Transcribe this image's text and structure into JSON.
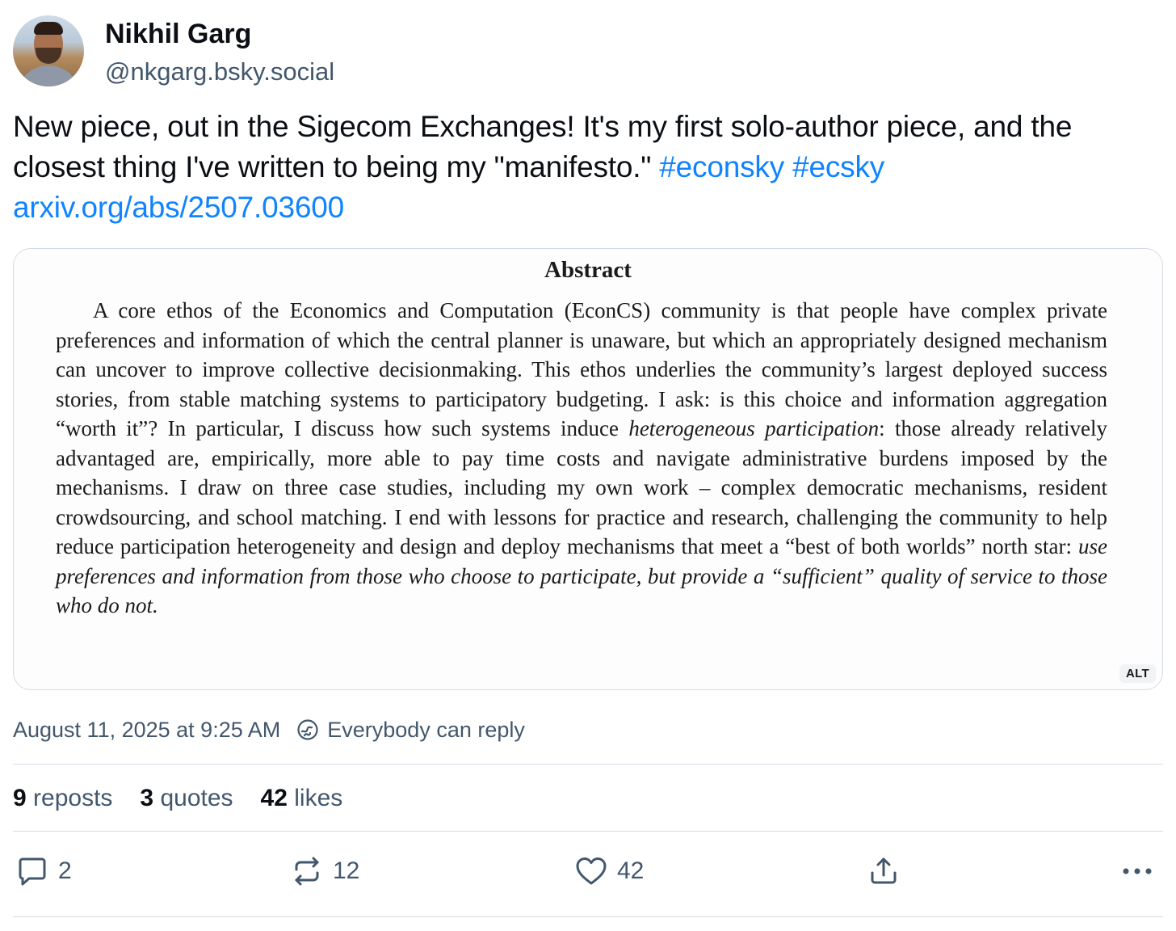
{
  "author": {
    "display_name": "Nikhil Garg",
    "handle": "@nkgarg.bsky.social"
  },
  "post": {
    "text_before_tags": "New piece, out in the Sigecom Exchanges! It's my first solo-author piece, and the closest thing I've written to being my \"manifesto.\" ",
    "hashtags": [
      "#econsky",
      "#ecsky"
    ],
    "link": "arxiv.org/abs/2507.03600"
  },
  "image": {
    "title": "Abstract",
    "body_plain_1": "A core ethos of the Economics and Computation (EconCS) community is that people have complex private preferences and information of which the central planner is unaware, but which an appropriately designed mechanism can uncover to improve collective decisionmaking.  This ethos underlies the community’s largest deployed success stories, from stable matching systems to participatory budgeting.  I ask:  is this choice and information aggregation “worth it”?  In particular, I discuss how such systems induce ",
    "body_italic_1": "heterogeneous participation",
    "body_plain_2": ": those already relatively advantaged are, empirically, more able to pay time costs and navigate administrative burdens imposed by the mechanisms.  I draw on three case studies, including my own work – complex democratic mechanisms, resident crowdsourcing, and school matching.  I end with lessons for practice and research, challenging the community to help reduce participation heterogeneity and design and deploy mechanisms that meet a “best of both worlds” north star: ",
    "body_italic_2": "use preferences and information from those who choose to participate, but provide a “sufficient” quality of service to those who do not.",
    "alt_badge": "ALT"
  },
  "meta": {
    "timestamp": "August 11, 2025 at 9:25 AM",
    "reply_setting": "Everybody can reply",
    "reply_icon": "globe-reply-icon"
  },
  "counts": {
    "reposts_num": "9",
    "reposts_label": "reposts",
    "quotes_num": "3",
    "quotes_label": "quotes",
    "likes_num": "42",
    "likes_label": "likes"
  },
  "actions": {
    "reply_count": "2",
    "repost_count": "12",
    "like_count": "42",
    "icons": [
      "reply-icon",
      "repost-icon",
      "like-icon",
      "share-icon",
      "more-icon"
    ]
  },
  "colors": {
    "link": "#1083fe",
    "secondary_text": "#42576c",
    "border": "#d4dbe2"
  }
}
